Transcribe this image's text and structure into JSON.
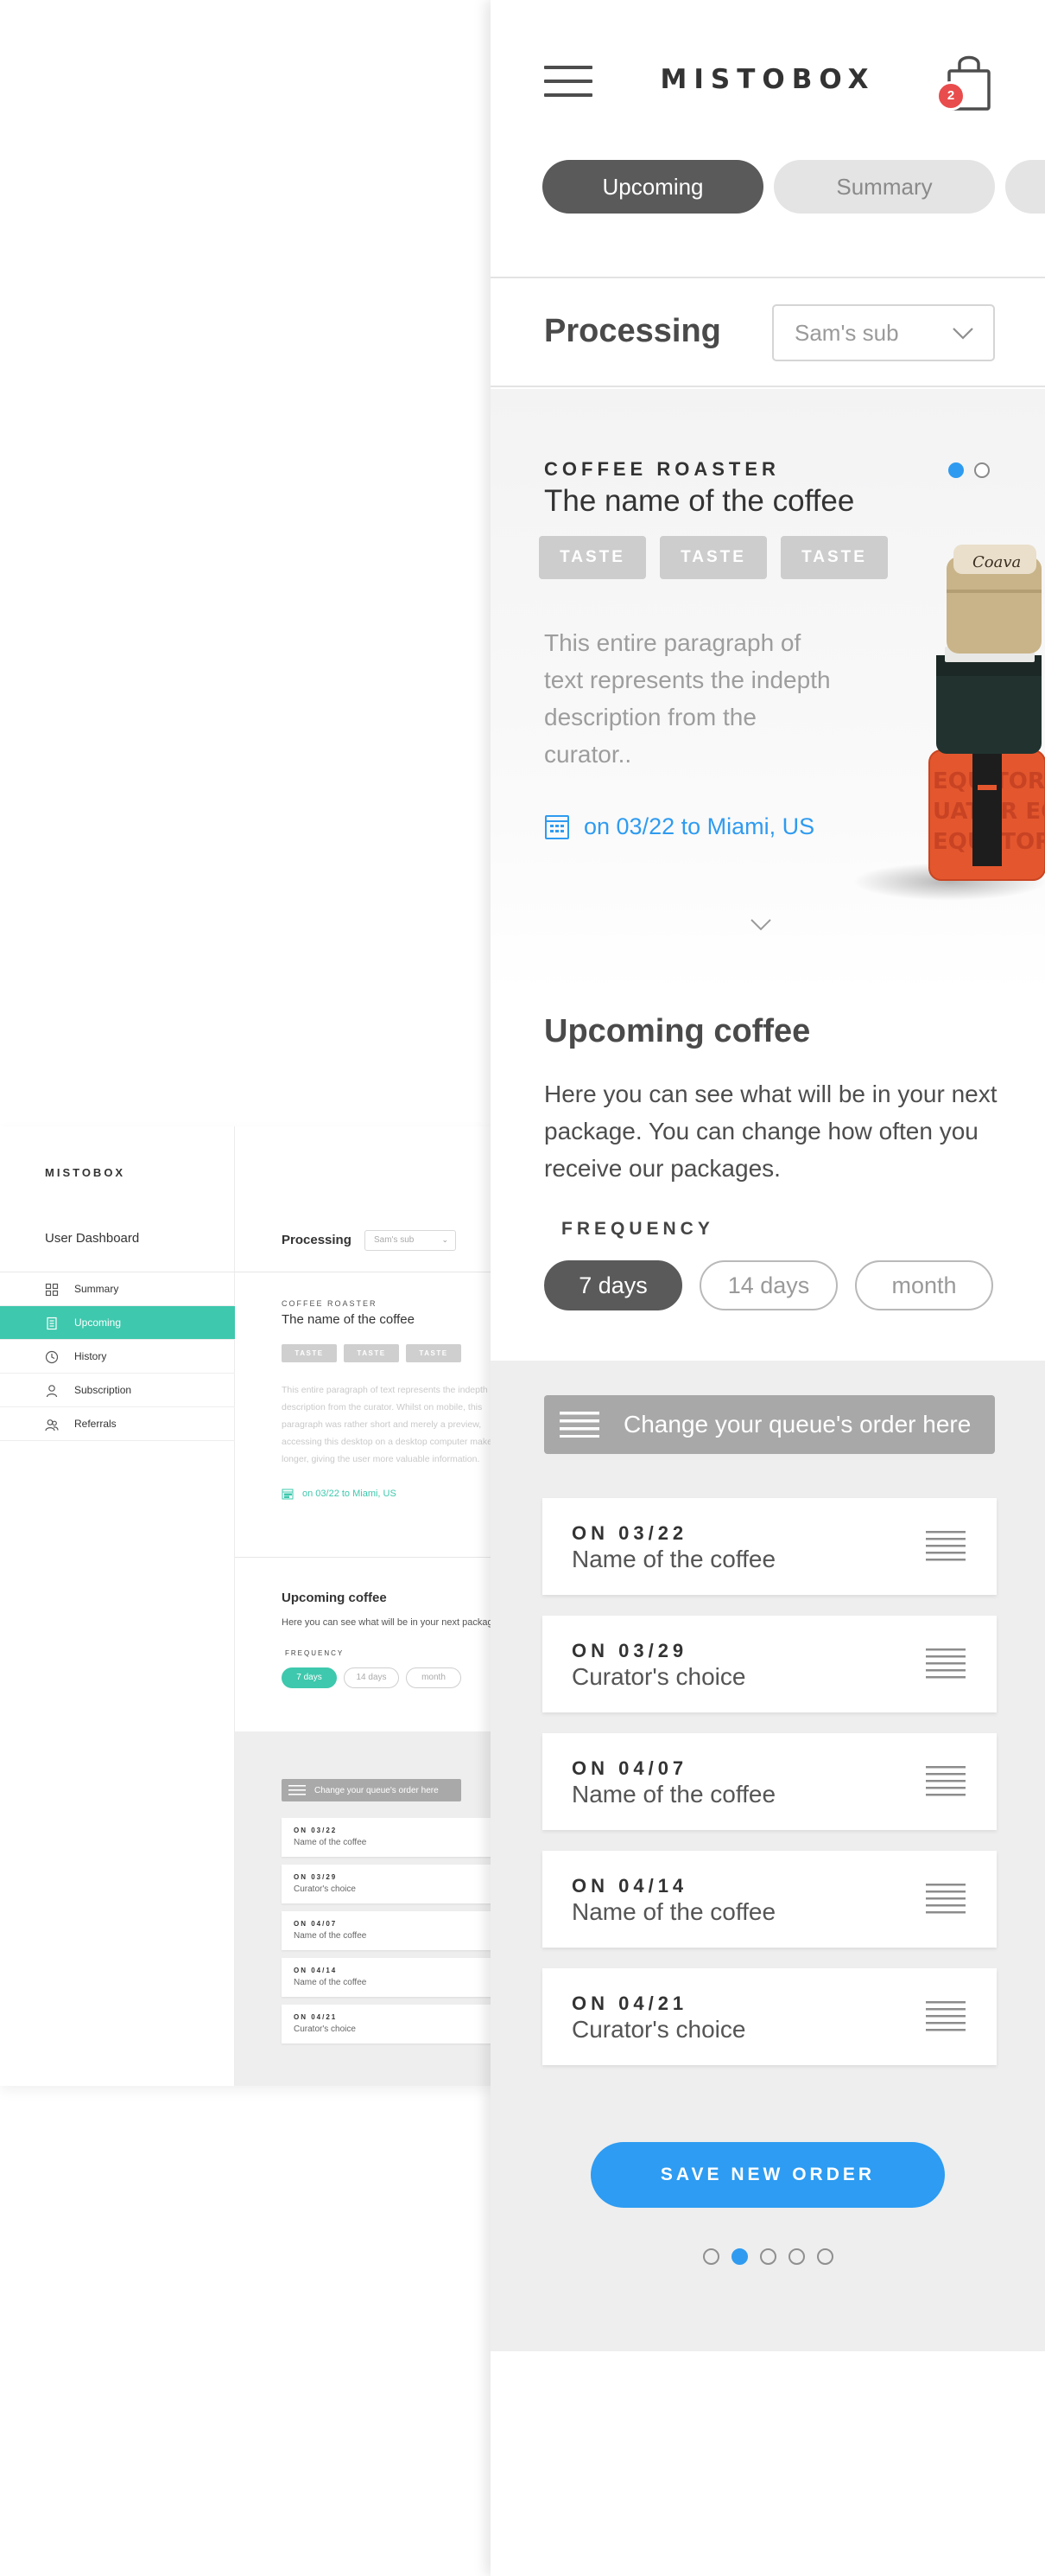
{
  "desktop": {
    "logo": "MISTOBOX",
    "dashboard_title": "User Dashboard",
    "nav": [
      {
        "label": "Summary",
        "icon": "grid-icon"
      },
      {
        "label": "Upcoming",
        "icon": "document-icon",
        "active": true
      },
      {
        "label": "History",
        "icon": "clock-icon"
      },
      {
        "label": "Subscription",
        "icon": "user-icon"
      },
      {
        "label": "Referrals",
        "icon": "users-icon"
      }
    ],
    "processing_title": "Processing",
    "subscription_select": "Sam's sub",
    "roaster_label": "COFFEE ROASTER",
    "coffee_name": "The name of the coffee",
    "tastes": [
      "TASTE",
      "TASTE",
      "TASTE"
    ],
    "description": "This entire paragraph of text represents the indepth description from the curator. Whilst on mobile, this paragraph was rather short and merely a preview, accessing this desktop on a desktop computer makes it longer, giving the user more valuable information.",
    "delivery": "on 03/22 to Miami, US",
    "upcoming_title": "Upcoming coffee",
    "upcoming_text": "Here you can see what will be in your next package. You can change how often you receive our packages.",
    "frequency_label": "FREQUENCY",
    "frequency_options": [
      "7 days",
      "14 days",
      "month"
    ],
    "queue_button": "Change your queue's order here",
    "queue": [
      {
        "date": "ON 03/22",
        "name": "Name of the coffee"
      },
      {
        "date": "ON 03/29",
        "name": "Curator's choice"
      },
      {
        "date": "ON 04/07",
        "name": "Name of the coffee"
      },
      {
        "date": "ON 04/14",
        "name": "Name of the coffee"
      },
      {
        "date": "ON 04/21",
        "name": "Curator's choice"
      }
    ],
    "accent_color": "#3ec8ad"
  },
  "mobile": {
    "logo": "MISTOBOX",
    "cart_count": "2",
    "tabs": [
      "Upcoming",
      "Summary",
      ""
    ],
    "active_tab": 0,
    "processing_title": "Processing",
    "subscription_select": "Sam's sub",
    "roaster_label": "COFFEE ROASTER",
    "coffee_name": "The name of the coffee",
    "tastes": [
      "TASTE",
      "TASTE",
      "TASTE"
    ],
    "description": "This entire paragraph of text represents the indepth description from the curator..",
    "delivery": "on 03/22 to Miami, US",
    "coffee_slide_index": 0,
    "coffee_slide_count": 2,
    "upcoming_title": "Upcoming coffee",
    "upcoming_text": "Here you can see what will be in your next package. You can change how often you receive our packages.",
    "frequency_label": "FREQUENCY",
    "frequency_options": [
      "7 days",
      "14 days",
      "month"
    ],
    "selected_frequency": 0,
    "queue_button": "Change your queue's order here",
    "queue": [
      {
        "date": "ON 03/22",
        "name": "Name of the coffee"
      },
      {
        "date": "ON 03/29",
        "name": "Curator's choice"
      },
      {
        "date": "ON 04/07",
        "name": "Name of the coffee"
      },
      {
        "date": "ON 04/14",
        "name": "Name of the coffee"
      },
      {
        "date": "ON 04/21",
        "name": "Curator's choice"
      }
    ],
    "save_button": "SAVE NEW ORDER",
    "pager_index": 1,
    "pager_count": 5,
    "accent_color": "#2f9bf0",
    "badge_color": "#e94c4c"
  }
}
